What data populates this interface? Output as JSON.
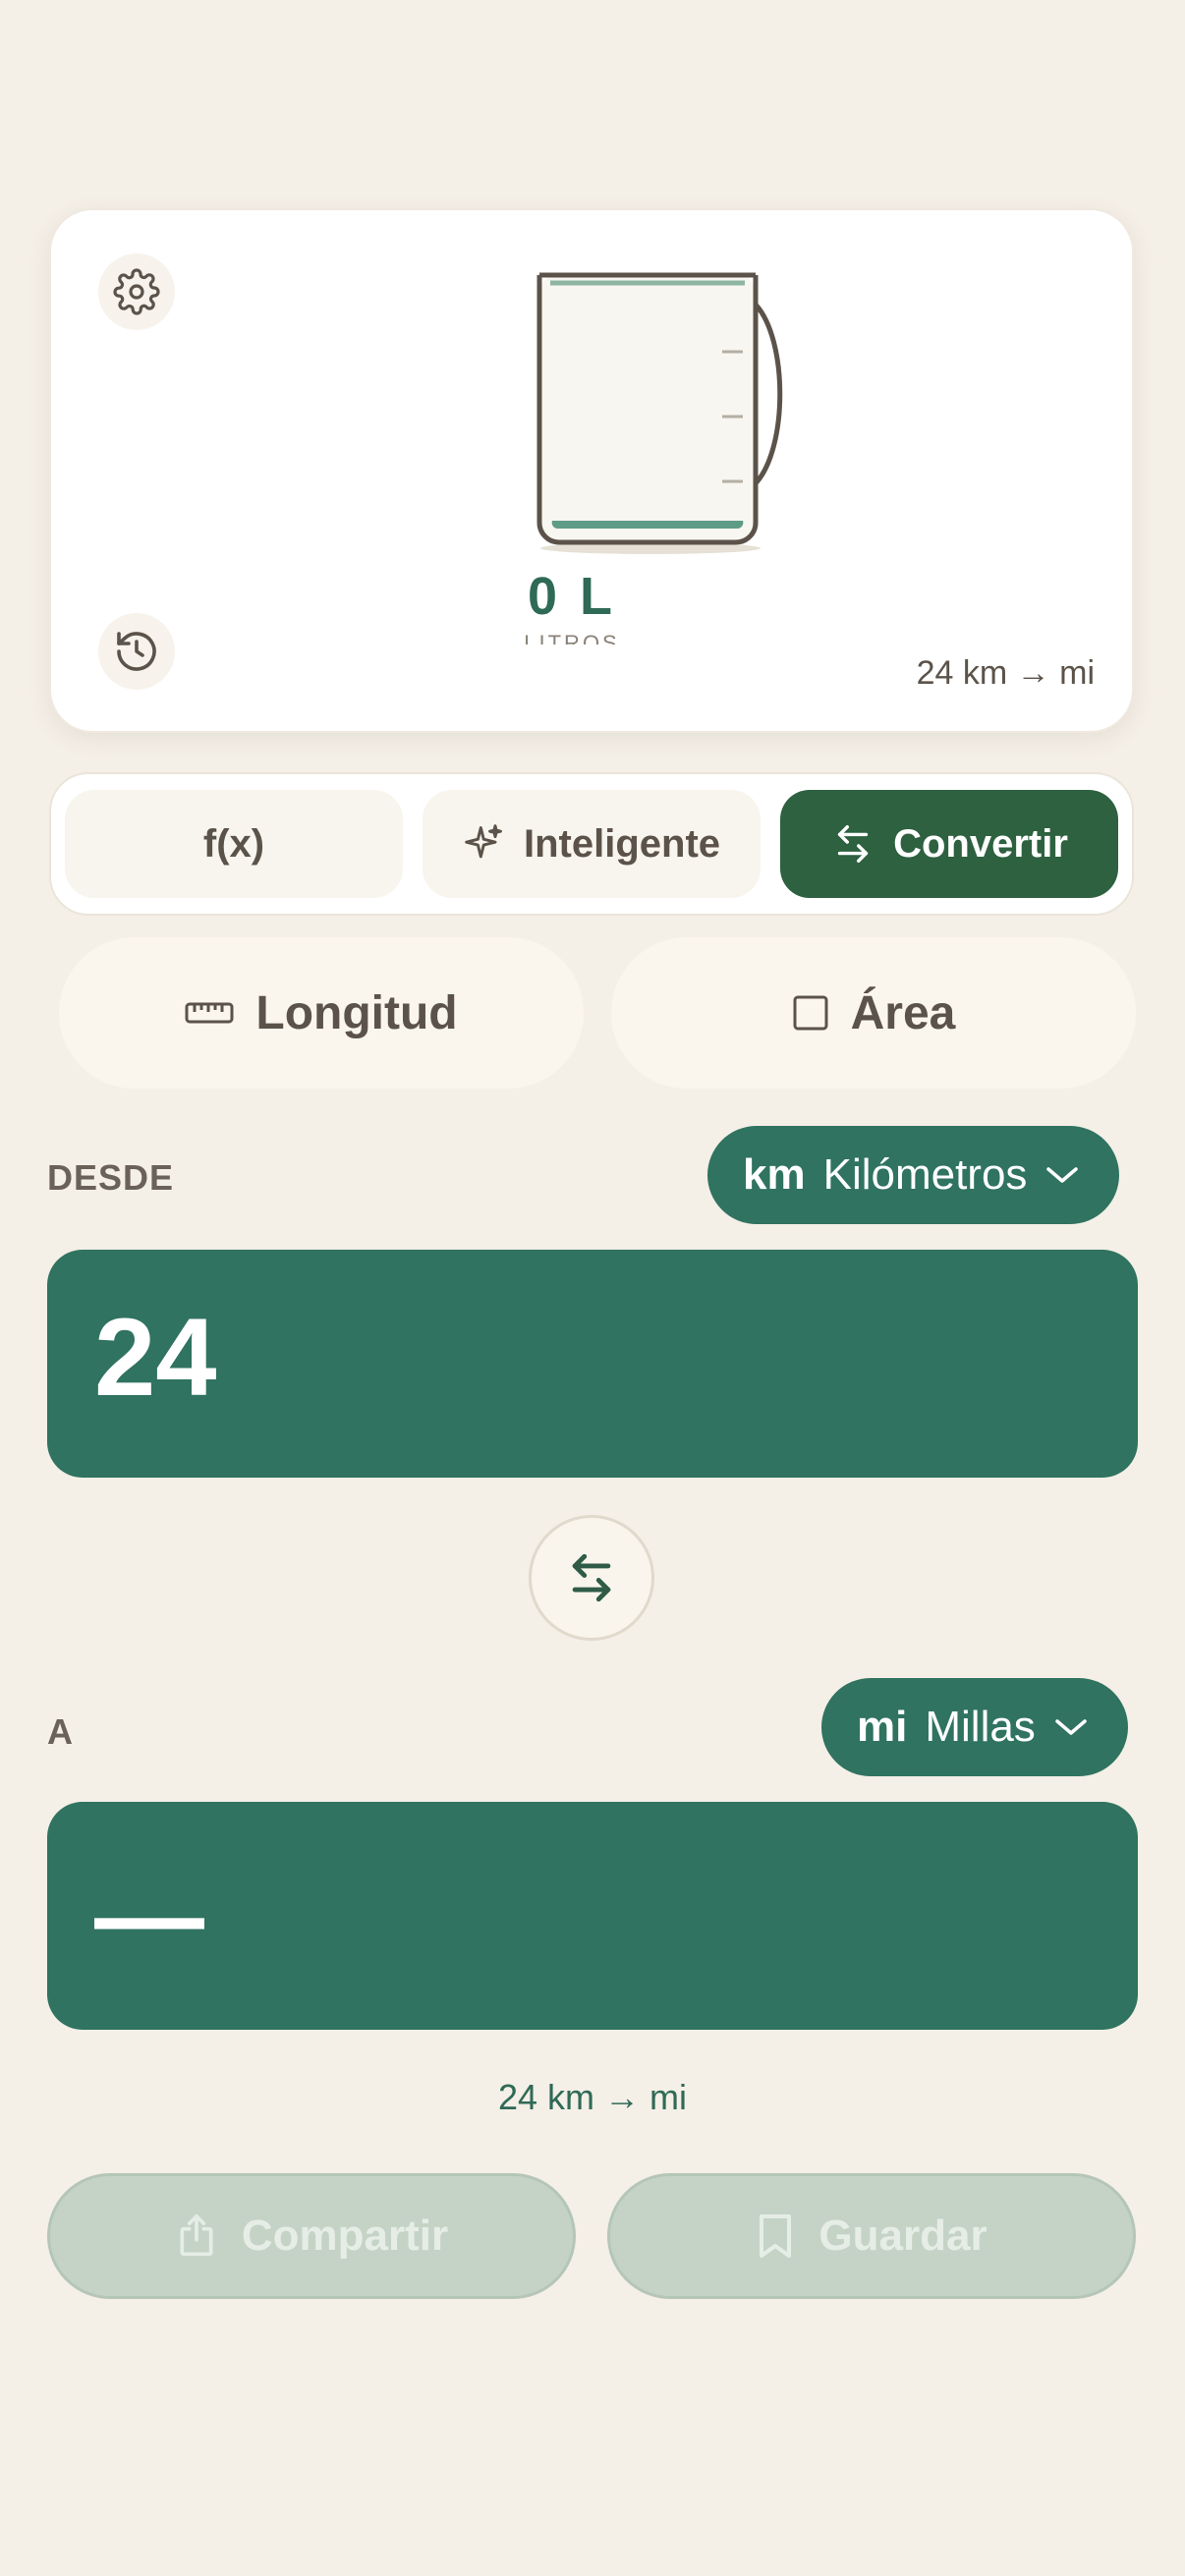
{
  "preview": {
    "volume_value": "0 L",
    "volume_unit_label": "LITROS",
    "summary": "24 km → mi"
  },
  "modes": [
    {
      "label": "f(x)"
    },
    {
      "label": "Inteligente"
    },
    {
      "label": "Convertir"
    }
  ],
  "categories": [
    {
      "label": "Longitud"
    },
    {
      "label": "Área"
    }
  ],
  "from": {
    "label": "DESDE",
    "unit_abbr": "km",
    "unit_name": "Kilómetros",
    "value": "24"
  },
  "to": {
    "label": "A",
    "unit_abbr": "mi",
    "unit_name": "Millas",
    "value": "—"
  },
  "conversion_summary": "24 km → mi",
  "actions": {
    "share_label": "Compartir",
    "save_label": "Guardar"
  },
  "colors": {
    "accent_green": "#2f7360",
    "dark_green": "#2d6140",
    "background": "#f4efe7"
  }
}
